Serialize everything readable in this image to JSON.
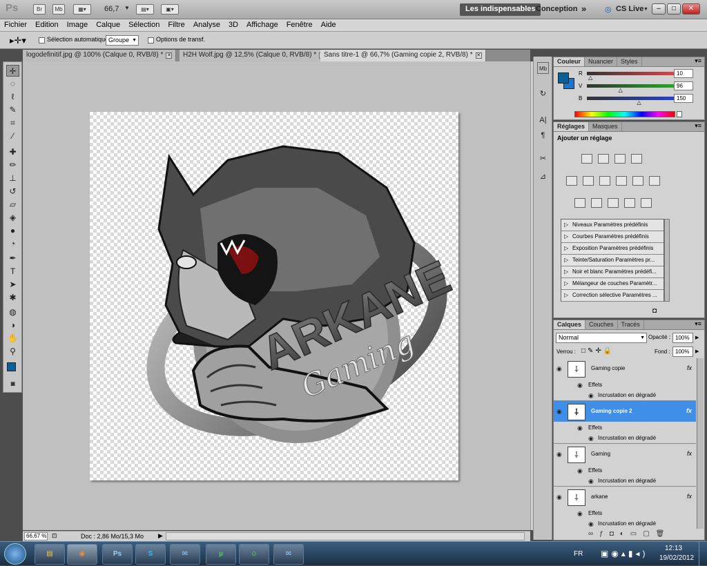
{
  "app": {
    "logo": "Ps",
    "zoom": "66,7",
    "workspace_active": "Les indispensables",
    "workspace_other": "Conception",
    "overflow": "»",
    "cslive": "CS Live",
    "win_min": "–",
    "win_max": "□",
    "win_close": "✕",
    "icon_names": [
      "bridge-icon",
      "minibridge-icon",
      "view-extras-icon",
      "arrange-docs-icon",
      "screen-mode-icon"
    ]
  },
  "menu": [
    "Fichier",
    "Edition",
    "Image",
    "Calque",
    "Sélection",
    "Filtre",
    "Analyse",
    "3D",
    "Affichage",
    "Fenêtre",
    "Aide"
  ],
  "options": {
    "auto_select_label": "Sélection automatique :",
    "auto_select_value": "Groupe",
    "transform_label": "Options de transf."
  },
  "tabs": [
    {
      "label": "logodefinitif.jpg @ 100% (Calque 0, RVB/8) *",
      "active": false
    },
    {
      "label": "H2H Wolf.jpg @ 12,5% (Calque 0, RVB/8) *",
      "active": false
    },
    {
      "label": "Sans titre-1 @ 66,7% (Gaming copie 2, RVB/8) *",
      "active": true
    }
  ],
  "canvas": {
    "logo_text": "ARKANE",
    "script_text": "Gaming"
  },
  "status": {
    "zoom": "66,67 %",
    "doc": "Doc : 2,86 Mo/15,3 Mo"
  },
  "color_panel": {
    "tabs": [
      "Couleur",
      "Nuancier",
      "Styles"
    ],
    "channels": [
      {
        "label": "R",
        "value": "10",
        "fraction": 0.04,
        "color": "#d44"
      },
      {
        "label": "V",
        "value": "96",
        "fraction": 0.38,
        "color": "#2a2"
      },
      {
        "label": "B",
        "value": "150",
        "fraction": 0.59,
        "color": "#24c"
      }
    ],
    "fg_color": "#0a6096",
    "bg_color": "#1a74d0"
  },
  "adjust_panel": {
    "tabs": [
      "Réglages",
      "Masques"
    ],
    "title": "Ajouter un réglage",
    "presets": [
      "Niveaux Paramètres prédéfinis",
      "Courbes Paramètres prédéfinis",
      "Exposition Paramètres prédéfinis",
      "Teinte/Saturation Paramètres pr...",
      "Noir et blanc Paramètres prédéfi...",
      "Mélangeur de couches Paramètr...",
      "Correction sélective Paramètres ..."
    ]
  },
  "layers_panel": {
    "tabs": [
      "Calques",
      "Couches",
      "Tracés"
    ],
    "blend_mode": "Normal",
    "opacity_label": "Opacité :",
    "opacity_value": "100%",
    "lock_label": "Verrou :",
    "fill_label": "Fond :",
    "fill_value": "100%",
    "fx": "fx",
    "layers": [
      {
        "name": "Gaming copie",
        "effects": "Effets",
        "effect": "Incrustation en dégradé",
        "selected": false
      },
      {
        "name": "Gaming copie 2",
        "effects": "Effets",
        "effect": "Incrustation en dégradé",
        "selected": true
      },
      {
        "name": "Gaming",
        "effects": "Effets",
        "effect": "Incrustation en dégradé",
        "selected": false
      },
      {
        "name": "arkane",
        "effects": "Effets",
        "effect": "Incrustation en dégradé",
        "selected": false
      }
    ]
  },
  "taskbar": {
    "apps": [
      "explorer-icon",
      "firefox-icon",
      "photoshop-icon",
      "skype-icon",
      "thunderbird-icon",
      "utorrent-icon",
      "messenger-icon",
      "thunderbird-icon"
    ],
    "ps_label": "Ps",
    "lang": "FR",
    "time": "12:13",
    "date": "19/02/2012"
  }
}
